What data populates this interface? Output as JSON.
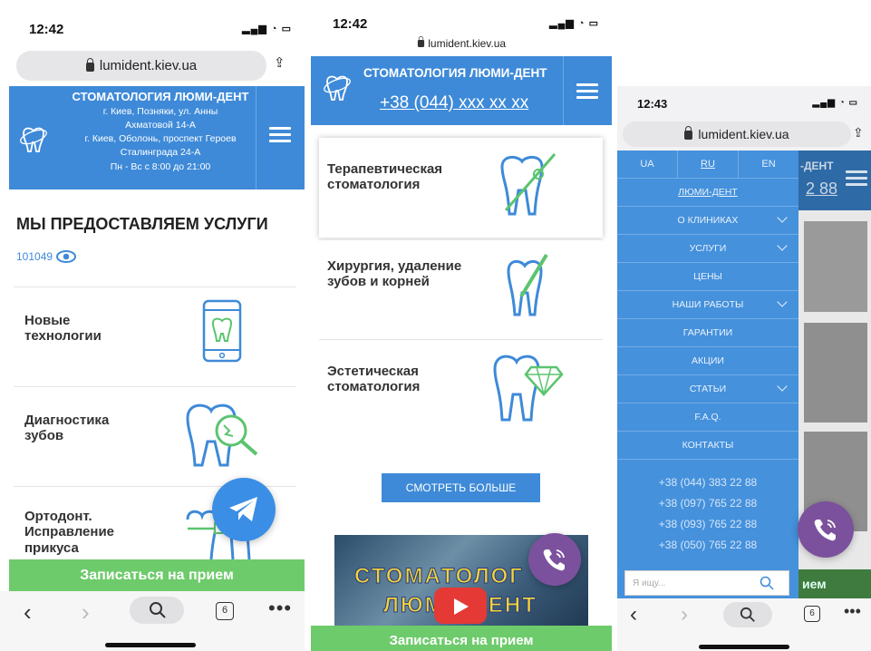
{
  "phone1": {
    "time": "12:42",
    "url": "lumident.kiev.ua",
    "header": {
      "title": "СТОМАТОЛОГИЯ ЛЮМИ-ДЕНТ",
      "address1": "г. Киев, Позняки, ул. Анны Ахматовой 14-А",
      "address2": "г. Киев, Оболонь, проспект Героев Сталинграда 24-А",
      "hours": "Пн - Вс с 8:00 до 21:00"
    },
    "section_title": "МЫ ПРЕДОСТАВЛЯЕМ УСЛУГИ",
    "views": "101049",
    "services": [
      "Новые технологии",
      "Диагностика зубов",
      "Ортодонт. Исправление прикуса"
    ],
    "cta": "Записаться на прием",
    "tabs_count": "6"
  },
  "phone2": {
    "time": "12:42",
    "url": "lumident.kiev.ua",
    "header": {
      "title": "СТОМАТОЛОГИЯ ЛЮМИ-ДЕНТ",
      "phone": "+38 (044) xxx xx xx"
    },
    "services": [
      "Терапевтическая стоматология",
      "Хирургия, удаление зубов и корней",
      "Эстетическая стоматология"
    ],
    "more_button": "СМОТРЕТЬ БОЛЬШЕ",
    "video_text1": "СТОМАТОЛОГ",
    "video_text2": "ЛЮМИ-ДЕНТ",
    "cta": "Записаться на прием"
  },
  "phone3": {
    "time": "12:43",
    "url": "lumident.kiev.ua",
    "langs": [
      "UA",
      "RU",
      "EN"
    ],
    "menu": [
      {
        "label": "ЛЮМИ-ДЕНТ",
        "chevron": false
      },
      {
        "label": "О КЛИНИКАХ",
        "chevron": true
      },
      {
        "label": "УСЛУГИ",
        "chevron": true
      },
      {
        "label": "ЦЕНЫ",
        "chevron": false
      },
      {
        "label": "НАШИ РАБОТЫ",
        "chevron": true
      },
      {
        "label": "ГАРАНТИИ",
        "chevron": false
      },
      {
        "label": "АКЦИИ",
        "chevron": false
      },
      {
        "label": "СТАТЬИ",
        "chevron": true
      },
      {
        "label": "F.A.Q.",
        "chevron": false
      },
      {
        "label": "КОНТАКТЫ",
        "chevron": false
      }
    ],
    "phones": [
      "+38 (044) 383 22 88",
      "+38 (097) 765 22 88",
      "+38 (093) 765 22 88",
      "+38 (050) 765 22 88"
    ],
    "search_placeholder": "Я ищу...",
    "behind_header": "-ДЕНТ",
    "behind_phone": "2 88",
    "behind_cta": "ием",
    "tabs_count": "6"
  },
  "colors": {
    "brand_blue": "#3e8ad8",
    "cta_green": "#6ecb6b",
    "telegram": "#3a8ee6",
    "viber": "#7b519d",
    "youtube": "#e53935"
  }
}
